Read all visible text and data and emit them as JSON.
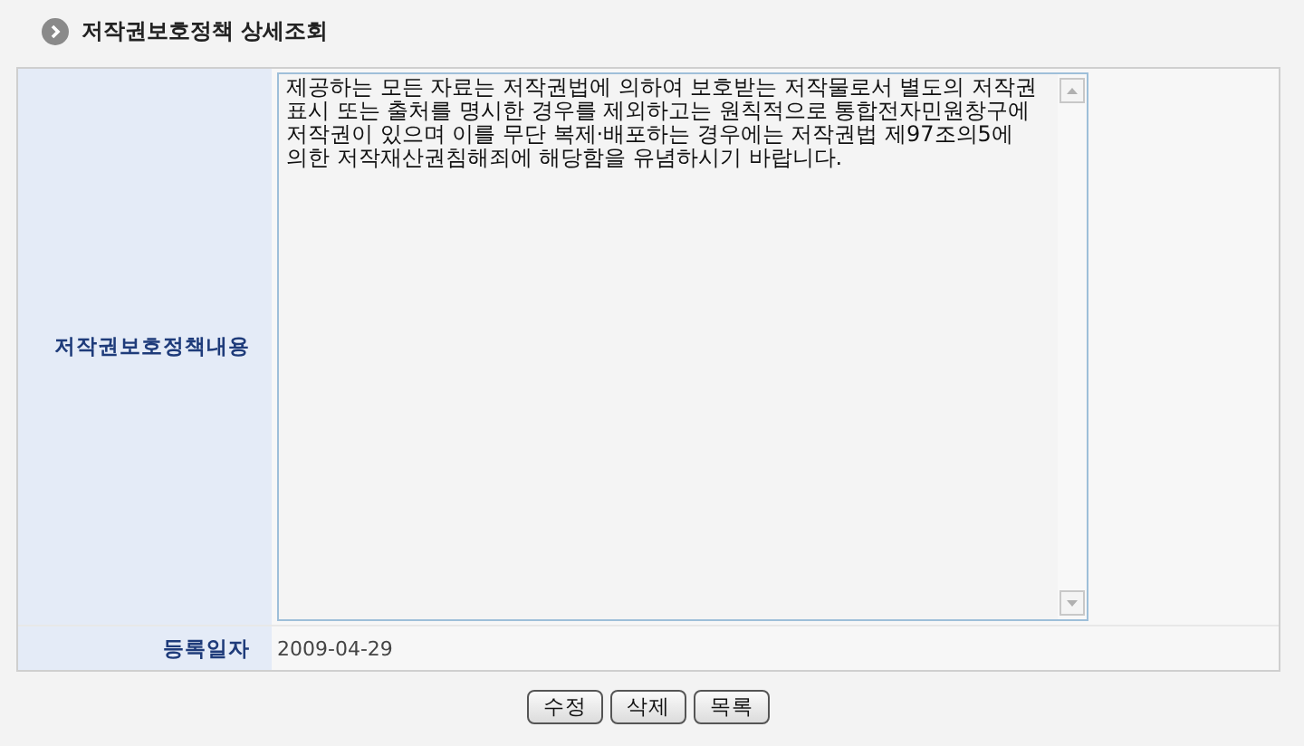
{
  "page_title": "저작권보호정책 상세조회",
  "rows": [
    {
      "kind": "textarea",
      "label": "저작권보호정책내용",
      "value": "제공하는 모든 자료는 저작권법에 의하여 보호받는 저작물로서 별도의 저작권 표시 또는 출처를  명시한 경우를 제외하고는 원칙적으로 통합전자민원창구에 저작권이 있으며 이를 무단 복제·배포하는 경우에는 저작권법  제97조의5에 의한 저작재산권침해죄에 해당함을 유념하시기 바랍니다."
    },
    {
      "kind": "text",
      "label": "등록일자",
      "value": "2009-04-29"
    }
  ],
  "buttons": [
    "수정",
    "삭제",
    "목록"
  ]
}
